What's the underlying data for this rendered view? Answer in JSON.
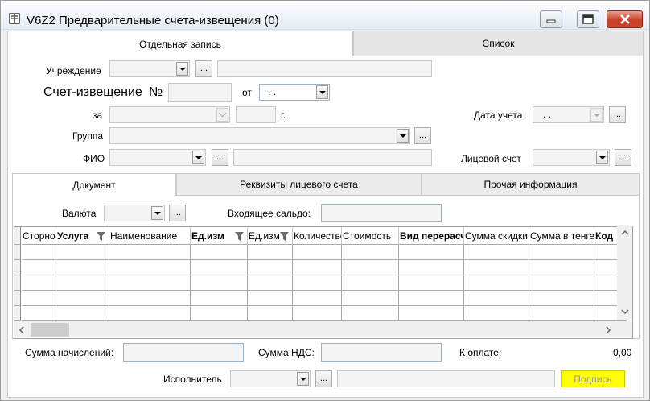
{
  "window": {
    "title": "V6Z2 Предварительные счета-извещения (0)"
  },
  "tabs": [
    "Отдельная запись",
    "Список"
  ],
  "form": {
    "institution_label": "Учреждение",
    "invoice_label": "Счет-извещение",
    "number_label": "№",
    "from_label": "от",
    "date_value": ". .",
    "for_label": "за",
    "year_label": "г.",
    "accounting_date_label": "Дата учета",
    "accounting_date_value": ". .",
    "group_label": "Группа",
    "fio_label": "ФИО",
    "personal_account_label": "Лицевой счет",
    "dots": "..."
  },
  "inner_tabs": [
    "Документ",
    "Реквизиты лицевого счета",
    "Прочая информация"
  ],
  "document": {
    "currency_label": "Валюта",
    "incoming_balance_label": "Входящее сальдо:"
  },
  "grid": {
    "columns": [
      {
        "label": "Сторно",
        "bold": false,
        "filter": false
      },
      {
        "label": "Услуга",
        "bold": true,
        "filter": true
      },
      {
        "label": "Наименование",
        "bold": false,
        "filter": false
      },
      {
        "label": "Ед.изм",
        "bold": true,
        "filter": true
      },
      {
        "label": "Ед.изм",
        "bold": false,
        "filter": true
      },
      {
        "label": "Количество",
        "bold": false,
        "filter": false
      },
      {
        "label": "Стоимость",
        "bold": false,
        "filter": false
      },
      {
        "label": "Вид перерасчета",
        "bold": true,
        "filter": false
      },
      {
        "label": "Сумма скидки",
        "bold": false,
        "filter": false
      },
      {
        "label": "Сумма в тенге",
        "bold": false,
        "filter": false
      },
      {
        "label": "Код",
        "bold": true,
        "filter": false
      }
    ],
    "row_count": 5
  },
  "footer": {
    "accruals_label": "Сумма начислений:",
    "vat_label": "Сумма НДС:",
    "to_pay_label": "К оплате:",
    "to_pay_value": "0,00",
    "executor_label": "Исполнитель",
    "sign_label": "Подпись"
  },
  "colors": {
    "sign_button": "#ffff00",
    "close_button": "#c8412a"
  }
}
